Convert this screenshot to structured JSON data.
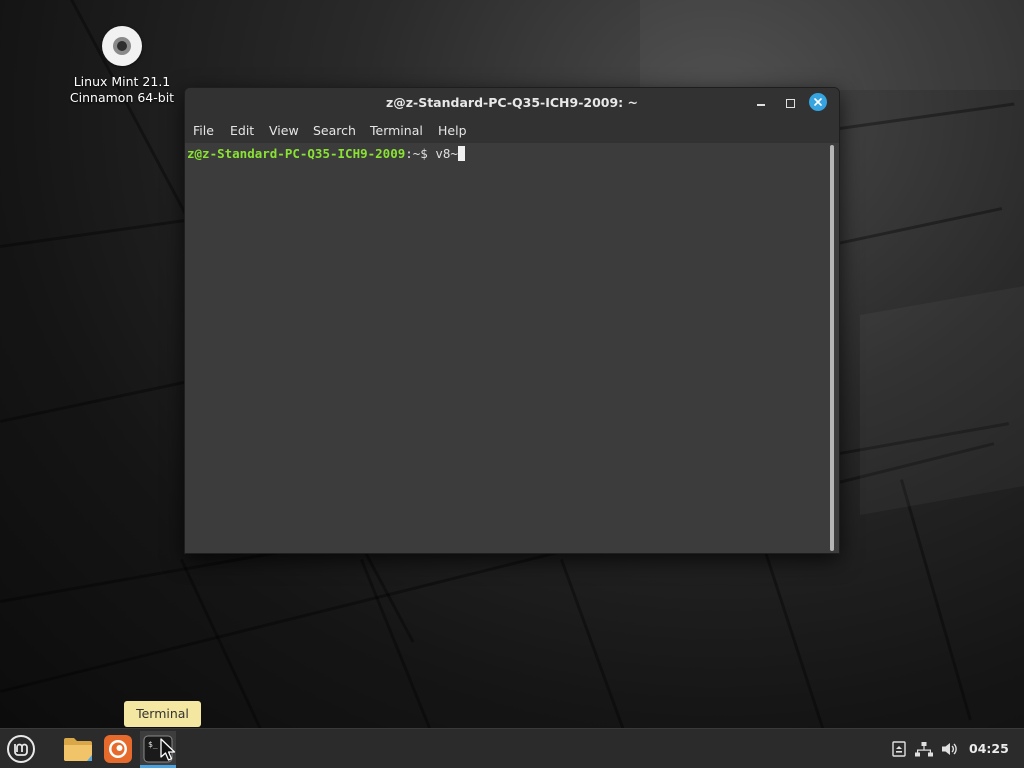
{
  "desktop": {
    "icon_label_line1": "Linux Mint 21.1",
    "icon_label_line2": "Cinnamon 64-bit"
  },
  "terminal": {
    "title": "z@z-Standard-PC-Q35-ICH9-2009: ~",
    "menu": [
      "File",
      "Edit",
      "View",
      "Search",
      "Terminal",
      "Help"
    ],
    "prompt_user": "z@z-Standard-PC-Q35-ICH9-2009",
    "prompt_suffix": ":~$ ",
    "typed_text": "v8~"
  },
  "tooltip": {
    "text": "Terminal"
  },
  "taskbar": {
    "clock": "04:25",
    "launchers": [
      "files",
      "firefox",
      "terminal"
    ],
    "tray_icons": [
      "removable-drive-icon",
      "network-icon",
      "volume-icon"
    ]
  },
  "colors": {
    "prompt_user": "#8ae234",
    "close_button": "#35a4e0",
    "tooltip_bg": "#f4e7a1",
    "active_indicator": "#4aa3df"
  }
}
